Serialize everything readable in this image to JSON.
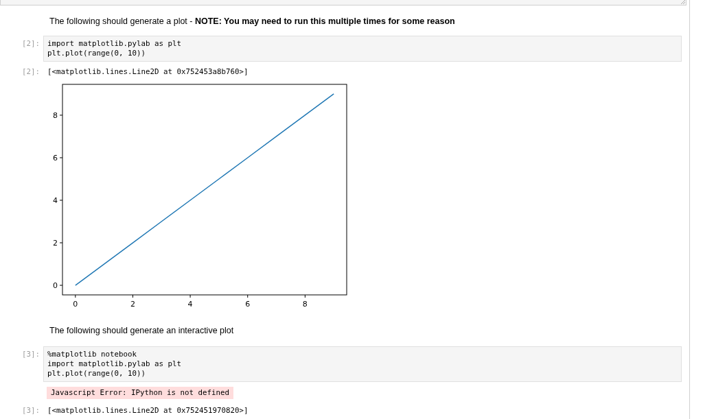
{
  "cells": [
    {
      "kind": "markdown",
      "text": "The following should generate a plot - **NOTE: You may need to run this multiple times for some reason**"
    },
    {
      "kind": "code",
      "prompt": "[2]:",
      "lines": [
        "import matplotlib.pylab as plt",
        "plt.plot(range(0, 10))"
      ]
    },
    {
      "kind": "output",
      "prompt": "[2]:",
      "text": "[<matplotlib.lines.Line2D at 0x752453a8b760>]",
      "chart_data": {
        "type": "line",
        "x": [
          0,
          1,
          2,
          3,
          4,
          5,
          6,
          7,
          8,
          9
        ],
        "series": [
          {
            "color": "#1f77b4",
            "values": [
              0,
              1,
              2,
              3,
              4,
              5,
              6,
              7,
              8,
              9
            ]
          }
        ],
        "xlim": [
          -0.45,
          9.45
        ],
        "ylim": [
          -0.45,
          9.45
        ],
        "xticks": [
          0,
          2,
          4,
          6,
          8
        ],
        "yticks": [
          0,
          2,
          4,
          6,
          8
        ]
      }
    },
    {
      "kind": "markdown",
      "text": "The following should generate an interactive plot"
    },
    {
      "kind": "code",
      "prompt": "[3]:",
      "lines": [
        "%matplotlib notebook",
        "import matplotlib.pylab as plt",
        "plt.plot(range(0, 10))"
      ]
    },
    {
      "kind": "error",
      "text": "Javascript Error: IPython is not defined"
    },
    {
      "kind": "output",
      "prompt": "[3]:",
      "text": "[<matplotlib.lines.Line2D at 0x752451970820>]"
    }
  ]
}
